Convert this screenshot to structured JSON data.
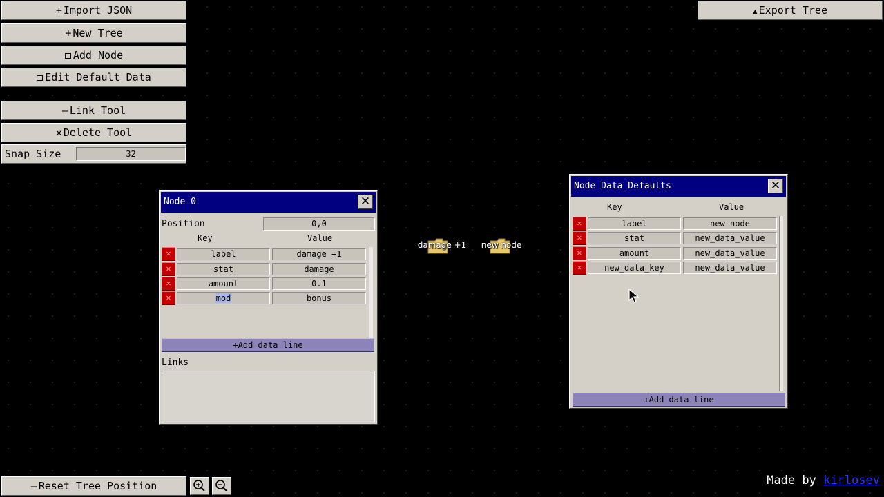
{
  "toolbar": {
    "import_json": "Import JSON",
    "new_tree": "New Tree",
    "add_node": "Add Node",
    "edit_default_data": "Edit Default Data",
    "link_tool": "Link Tool",
    "delete_tool": "Delete Tool",
    "snap_size_label": "Snap Size",
    "snap_size_value": "32",
    "export_tree": "Export Tree",
    "reset_tree_position": "Reset Tree Position"
  },
  "node_panel": {
    "title": "Node 0",
    "close": "✕",
    "position_label": "Position",
    "position_value": "0,0",
    "key_header": "Key",
    "value_header": "Value",
    "rows": [
      {
        "key": "label",
        "value": "damage +1"
      },
      {
        "key": "stat",
        "value": "damage"
      },
      {
        "key": "amount",
        "value": "0.1"
      },
      {
        "key": "mod",
        "value": "bonus"
      }
    ],
    "add_data_line": "+Add data line",
    "links_label": "Links"
  },
  "defaults_panel": {
    "title": "Node Data Defaults",
    "close": "✕",
    "key_header": "Key",
    "value_header": "Value",
    "rows": [
      {
        "key": "label",
        "value": "new node"
      },
      {
        "key": "stat",
        "value": "new_data_value"
      },
      {
        "key": "amount",
        "value": "new_data_value"
      },
      {
        "key": "new_data_key",
        "value": "new_data_value"
      }
    ],
    "add_data_line": "+Add data line"
  },
  "canvas_nodes": [
    {
      "label": "damage +1"
    },
    {
      "label": "new node"
    }
  ],
  "footer": {
    "made_by": "Made by",
    "author": "kirlosev"
  },
  "icons": {
    "import": "plus-icon",
    "new_tree": "plus-icon",
    "add_node": "square-icon",
    "edit_default": "square-icon",
    "link": "minus-icon",
    "delete": "x-icon",
    "export": "triangle-up-icon",
    "reset": "minus-icon",
    "zoom_in": "zoom-in-icon",
    "zoom_out": "zoom-out-icon",
    "node": "folder-icon",
    "row_delete": "x-icon"
  },
  "colors": {
    "titlebar": "#000080",
    "panel": "#d4d0c8",
    "delete_button": "#c40000",
    "add_line_button": "#8c84b8"
  }
}
